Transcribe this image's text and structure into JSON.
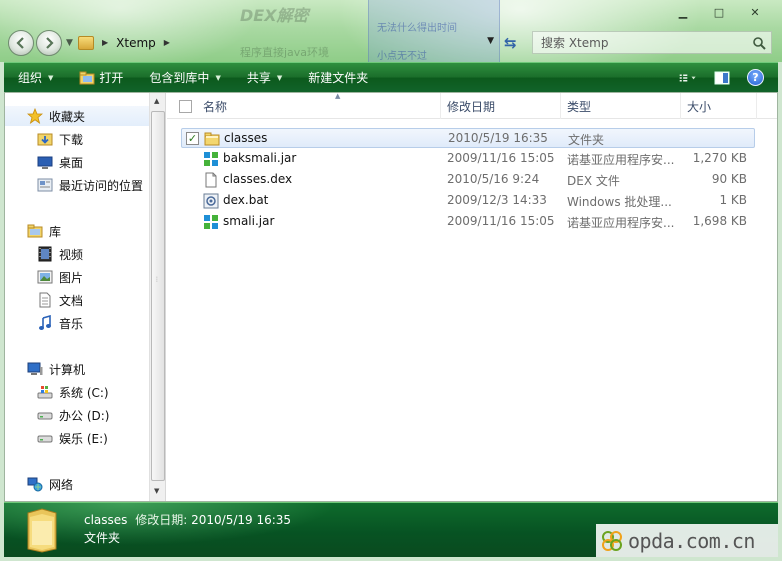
{
  "window": {
    "minimize_glyph": "▁",
    "maximize_glyph": "□",
    "close_glyph": "✕"
  },
  "background_ghost": {
    "title_text": "DEX解密",
    "line1": "程序直接java环境",
    "panel_line1": "无法什么得出时间",
    "panel_line2": "小点无不过"
  },
  "address": {
    "path_segments": [
      "Xtemp"
    ],
    "separator_glyph": "▶"
  },
  "search": {
    "placeholder": "搜索 Xtemp"
  },
  "toolbar": {
    "organize": "组织",
    "open": "打开",
    "include_in_library": "包含到库中",
    "share": "共享",
    "new_folder": "新建文件夹",
    "help_glyph": "?"
  },
  "sidebar": {
    "favorites": {
      "label": "收藏夹",
      "items": [
        "下载",
        "桌面",
        "最近访问的位置"
      ]
    },
    "libraries": {
      "label": "库",
      "items": [
        "视频",
        "图片",
        "文档",
        "音乐"
      ]
    },
    "computer": {
      "label": "计算机",
      "items": [
        "系统 (C:)",
        "办公 (D:)",
        "娱乐 (E:)"
      ]
    },
    "network": {
      "label": "网络"
    }
  },
  "columns": {
    "name": "名称",
    "date": "修改日期",
    "type": "类型",
    "size": "大小"
  },
  "files": [
    {
      "name": "classes",
      "date": "2010/5/19 16:35",
      "type": "文件夹",
      "size": "",
      "icon": "folder-icon",
      "selected": true
    },
    {
      "name": "baksmali.jar",
      "date": "2009/11/16 15:05",
      "type": "诺基亚应用程序安...",
      "size": "1,270 KB",
      "icon": "jar-icon",
      "selected": false
    },
    {
      "name": "classes.dex",
      "date": "2010/5/16 9:24",
      "type": "DEX 文件",
      "size": "90 KB",
      "icon": "file-icon",
      "selected": false
    },
    {
      "name": "dex.bat",
      "date": "2009/12/3 14:33",
      "type": "Windows 批处理...",
      "size": "1 KB",
      "icon": "bat-icon",
      "selected": false
    },
    {
      "name": "smali.jar",
      "date": "2009/11/16 15:05",
      "type": "诺基亚应用程序安...",
      "size": "1,698 KB",
      "icon": "jar-icon",
      "selected": false
    }
  ],
  "details": {
    "name": "classes",
    "modified_label": "修改日期:",
    "modified_value": "2010/5/19 16:35",
    "type": "文件夹"
  },
  "watermark": {
    "text": "opda.com.cn"
  },
  "colors": {
    "toolbar_green": "#1a6d2a",
    "details_green": "#075323",
    "selection_blue": "#e0ebfa",
    "header_text": "#3c4d6a"
  }
}
